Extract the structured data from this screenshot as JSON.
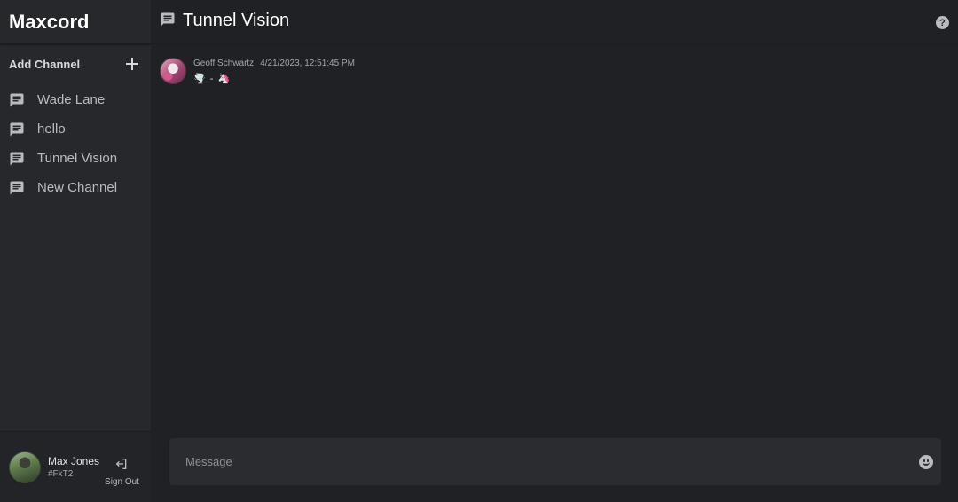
{
  "app": {
    "title": "Maxcord"
  },
  "sidebar": {
    "add_channel_label": "Add Channel",
    "add_icon": "plus-icon",
    "channels": [
      {
        "label": "Wade Lane",
        "icon": "chat-bubble-icon"
      },
      {
        "label": "hello",
        "icon": "chat-bubble-icon"
      },
      {
        "label": "Tunnel Vision",
        "icon": "chat-bubble-icon"
      },
      {
        "label": "New Channel",
        "icon": "chat-bubble-icon"
      }
    ]
  },
  "user": {
    "name": "Max Jones",
    "tag": "#FkT2",
    "signout_label": "Sign Out",
    "signout_icon": "sign-out-icon"
  },
  "header": {
    "channel_title": "Tunnel Vision",
    "help_icon": "help-icon",
    "help_glyph": "?"
  },
  "messages": [
    {
      "author": "Geoff Schwartz",
      "timestamp": "4/21/2023, 12:51:45 PM",
      "text": "🌪️ - 🦄"
    }
  ],
  "composer": {
    "placeholder": "Message",
    "emoji_icon": "smiley-icon"
  },
  "colors": {
    "background": "#202124",
    "sidebar": "#27282b",
    "composer": "#2b2c30",
    "text_primary": "#ffffff",
    "text_muted": "#b9bbbe"
  }
}
